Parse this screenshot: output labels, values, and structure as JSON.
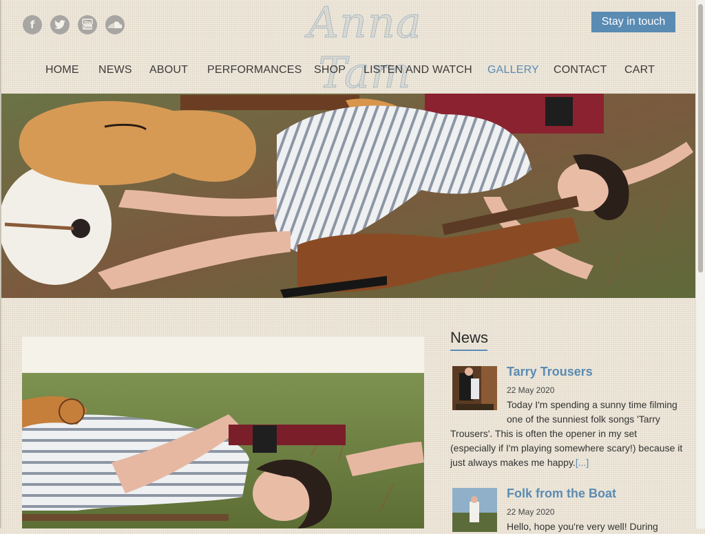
{
  "site": {
    "logo": "Anna Tam"
  },
  "social": [
    {
      "name": "facebook-icon",
      "glyph": "f"
    },
    {
      "name": "twitter-icon",
      "glyph": ""
    },
    {
      "name": "youtube-icon",
      "glyph": "You Tube"
    },
    {
      "name": "soundcloud-icon",
      "glyph": ""
    }
  ],
  "header": {
    "cta": "Stay in touch"
  },
  "nav": [
    {
      "label": "HOME"
    },
    {
      "label": "NEWS"
    },
    {
      "label": "ABOUT"
    },
    {
      "label": "PERFORMANCES"
    },
    {
      "label": "SHOP"
    },
    {
      "label": "LISTEN AND WATCH"
    },
    {
      "label": "GALLERY",
      "active": true
    },
    {
      "label": "CONTACT"
    },
    {
      "label": "CART"
    }
  ],
  "news": {
    "heading": "News",
    "items": [
      {
        "title": "Tarry Trousers",
        "date": "22 May 2020",
        "lines": [
          "Today I'm spending a sunny time filming",
          "one of the sunniest folk songs 'Tarry",
          "Trousers'. This is often the opener in my set",
          "(especially if I'm playing somewhere scary!) because it",
          "just always makes me happy."
        ],
        "more": "[...]"
      },
      {
        "title": "Folk from the Boat",
        "date": "22 May 2020",
        "lines": [
          "Hello, hope you're very well! During"
        ]
      }
    ]
  },
  "colors": {
    "accent": "#5a8bb3",
    "background": "#efe9dd"
  }
}
